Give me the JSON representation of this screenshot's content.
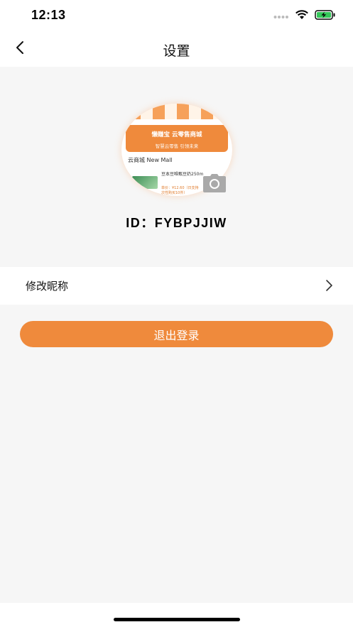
{
  "status_bar": {
    "time": "12:13",
    "icons": [
      "signal-dots-icon",
      "wifi-icon",
      "battery-charging-icon"
    ],
    "battery_color": "#34c759"
  },
  "header": {
    "title": "设置",
    "back_icon": "chevron-left-icon"
  },
  "avatar": {
    "banner_title": "懒赚宝 云零售商城",
    "banner_subtitle": "智慧云零售   引领未来",
    "mall_label": "云商城 New Mall",
    "product_name": "豆本豆唯甄豆奶250m",
    "product_price_line1": "单价：¥12.60（日支持",
    "product_price_line2": "次性购买10件）",
    "camera_icon": "camera-icon"
  },
  "user": {
    "id_text": "ID：FYBPJJIW"
  },
  "settings": {
    "items": [
      {
        "label": "修改昵称",
        "icon": "chevron-right-icon"
      }
    ]
  },
  "actions": {
    "logout_label": "退出登录"
  },
  "colors": {
    "accent": "#ef8a3c",
    "background": "#f6f6f6",
    "surface": "#ffffff"
  }
}
